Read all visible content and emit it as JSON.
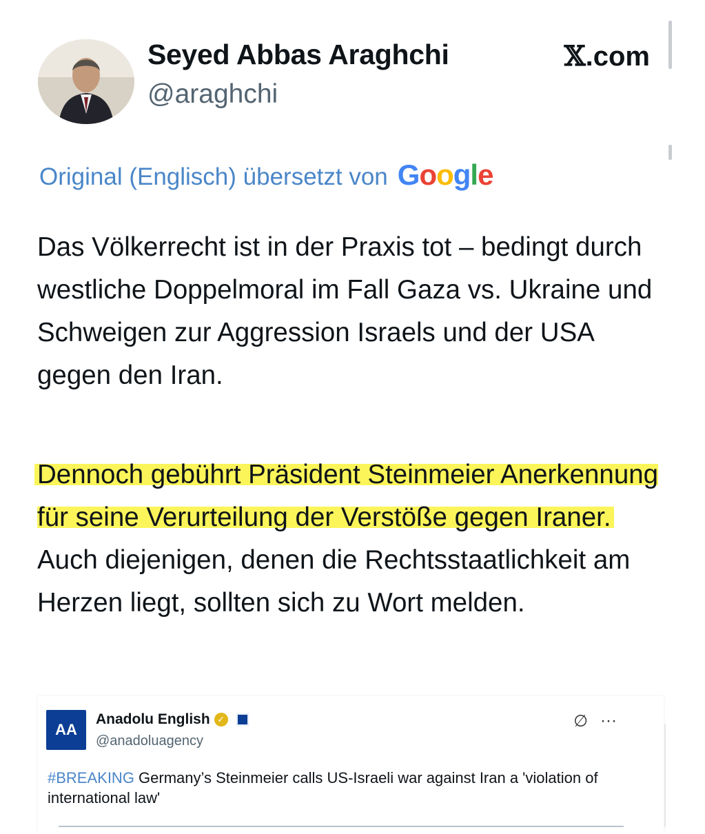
{
  "tweet": {
    "author_name": "Seyed Abbas Araghchi",
    "author_handle": "@araghchi",
    "site_x": "𝕏",
    "site_domain": ".com",
    "translation_prefix": "Original (Englisch) übersetzt von",
    "google_letters": [
      "G",
      "o",
      "o",
      "g",
      "l",
      "e"
    ],
    "paragraph1": "Das Völkerrecht ist in der Praxis tot – bedingt durch westliche Doppelmoral im Fall Gaza vs. Ukraine und Schweigen zur Aggression Israels und der USA gegen den Iran.",
    "paragraph2_highlighted": "Dennoch gebührt Präsident Steinmeier Anerkennung für seine Verurteilung der Verstöße gegen Iraner.",
    "paragraph2_rest": " Auch diejenigen, denen die Rechtsstaatlichkeit am Herzen liegt, sollten sich zu Wort melden.",
    "highlight_color": "#fbf55a"
  },
  "quoted": {
    "logo_text": "AA",
    "name": "Anadolu English",
    "handle": "@anadoluagency",
    "hashtag": "#BREAKING",
    "text": " Germany’s Steinmeier calls US-Israeli war against Iran a 'violation of international law'",
    "icons": {
      "grok": "∅",
      "more": "···"
    }
  }
}
